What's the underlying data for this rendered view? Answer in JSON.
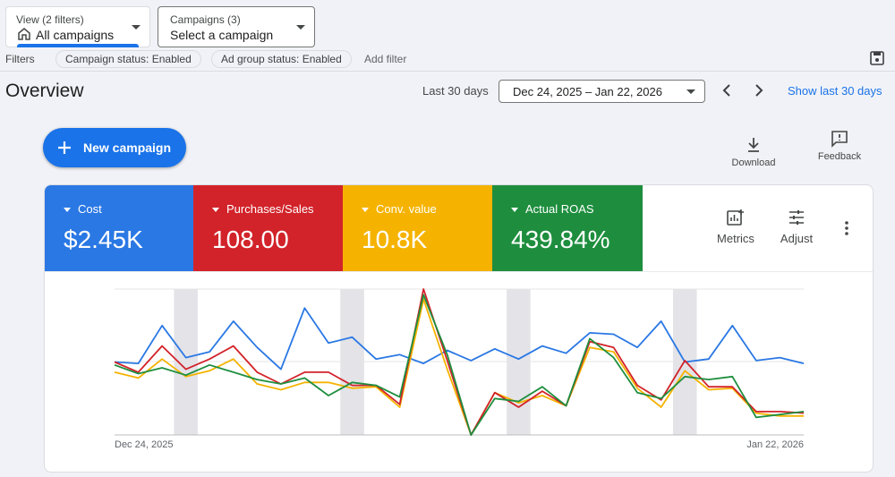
{
  "view_selector": {
    "label": "View (2 filters)",
    "value": "All campaigns"
  },
  "campaigns_selector": {
    "label": "Campaigns (3)",
    "value": "Select a campaign"
  },
  "filters": {
    "label": "Filters",
    "chips": [
      "Campaign status: Enabled",
      "Ad group status: Enabled"
    ],
    "add_filter": "Add filter"
  },
  "overview": {
    "title": "Overview",
    "range_label": "Last 30 days",
    "date_range": "Dec 24, 2025 – Jan 22, 2026",
    "show_last_link": "Show last 30 days"
  },
  "actions": {
    "new_campaign": "New campaign",
    "download": "Download",
    "feedback": "Feedback"
  },
  "metrics": [
    {
      "label": "Cost",
      "value": "$2.45K",
      "color": "#2a78e4"
    },
    {
      "label": "Purchases/Sales",
      "value": "108.00",
      "color": "#d2232a"
    },
    {
      "label": "Conv. value",
      "value": "10.8K",
      "color": "#f5b300"
    },
    {
      "label": "Actual ROAS",
      "value": "439.84%",
      "color": "#1e8e3e"
    }
  ],
  "controls": {
    "metrics": "Metrics",
    "adjust": "Adjust"
  },
  "chart_data": {
    "type": "line",
    "x_start_label": "Dec 24, 2025",
    "x_end_label": "Jan 22, 2026",
    "ylim": [
      0,
      100
    ],
    "weekend_bands": [
      3,
      10,
      17,
      24
    ],
    "series": [
      {
        "color": "#2a78e4",
        "values": [
          50,
          49,
          75,
          53,
          57,
          78,
          60,
          45,
          87,
          63,
          67,
          52,
          55,
          49,
          58,
          51,
          59,
          52,
          61,
          56,
          70,
          69,
          60,
          78,
          50,
          52,
          75,
          51,
          53,
          49
        ]
      },
      {
        "color": "#d2232a",
        "values": [
          50,
          43,
          61,
          45,
          52,
          61,
          43,
          35,
          43,
          43,
          34,
          34,
          21,
          100,
          51,
          0,
          29,
          19,
          30,
          20,
          64,
          60,
          34,
          24,
          51,
          33,
          33,
          16,
          16,
          15
        ]
      },
      {
        "color": "#f5b300",
        "values": [
          43,
          39,
          52,
          40,
          44,
          52,
          35,
          31,
          36,
          36,
          32,
          33,
          19,
          93,
          45,
          0,
          29,
          22,
          27,
          20,
          60,
          57,
          32,
          19,
          44,
          31,
          32,
          15,
          13,
          13
        ]
      },
      {
        "color": "#1e8e3e",
        "values": [
          48,
          42,
          46,
          41,
          48,
          43,
          38,
          35,
          39,
          27,
          36,
          34,
          26,
          96,
          55,
          0,
          25,
          23,
          33,
          20,
          66,
          53,
          29,
          25,
          40,
          38,
          40,
          12,
          14,
          16
        ]
      }
    ]
  }
}
